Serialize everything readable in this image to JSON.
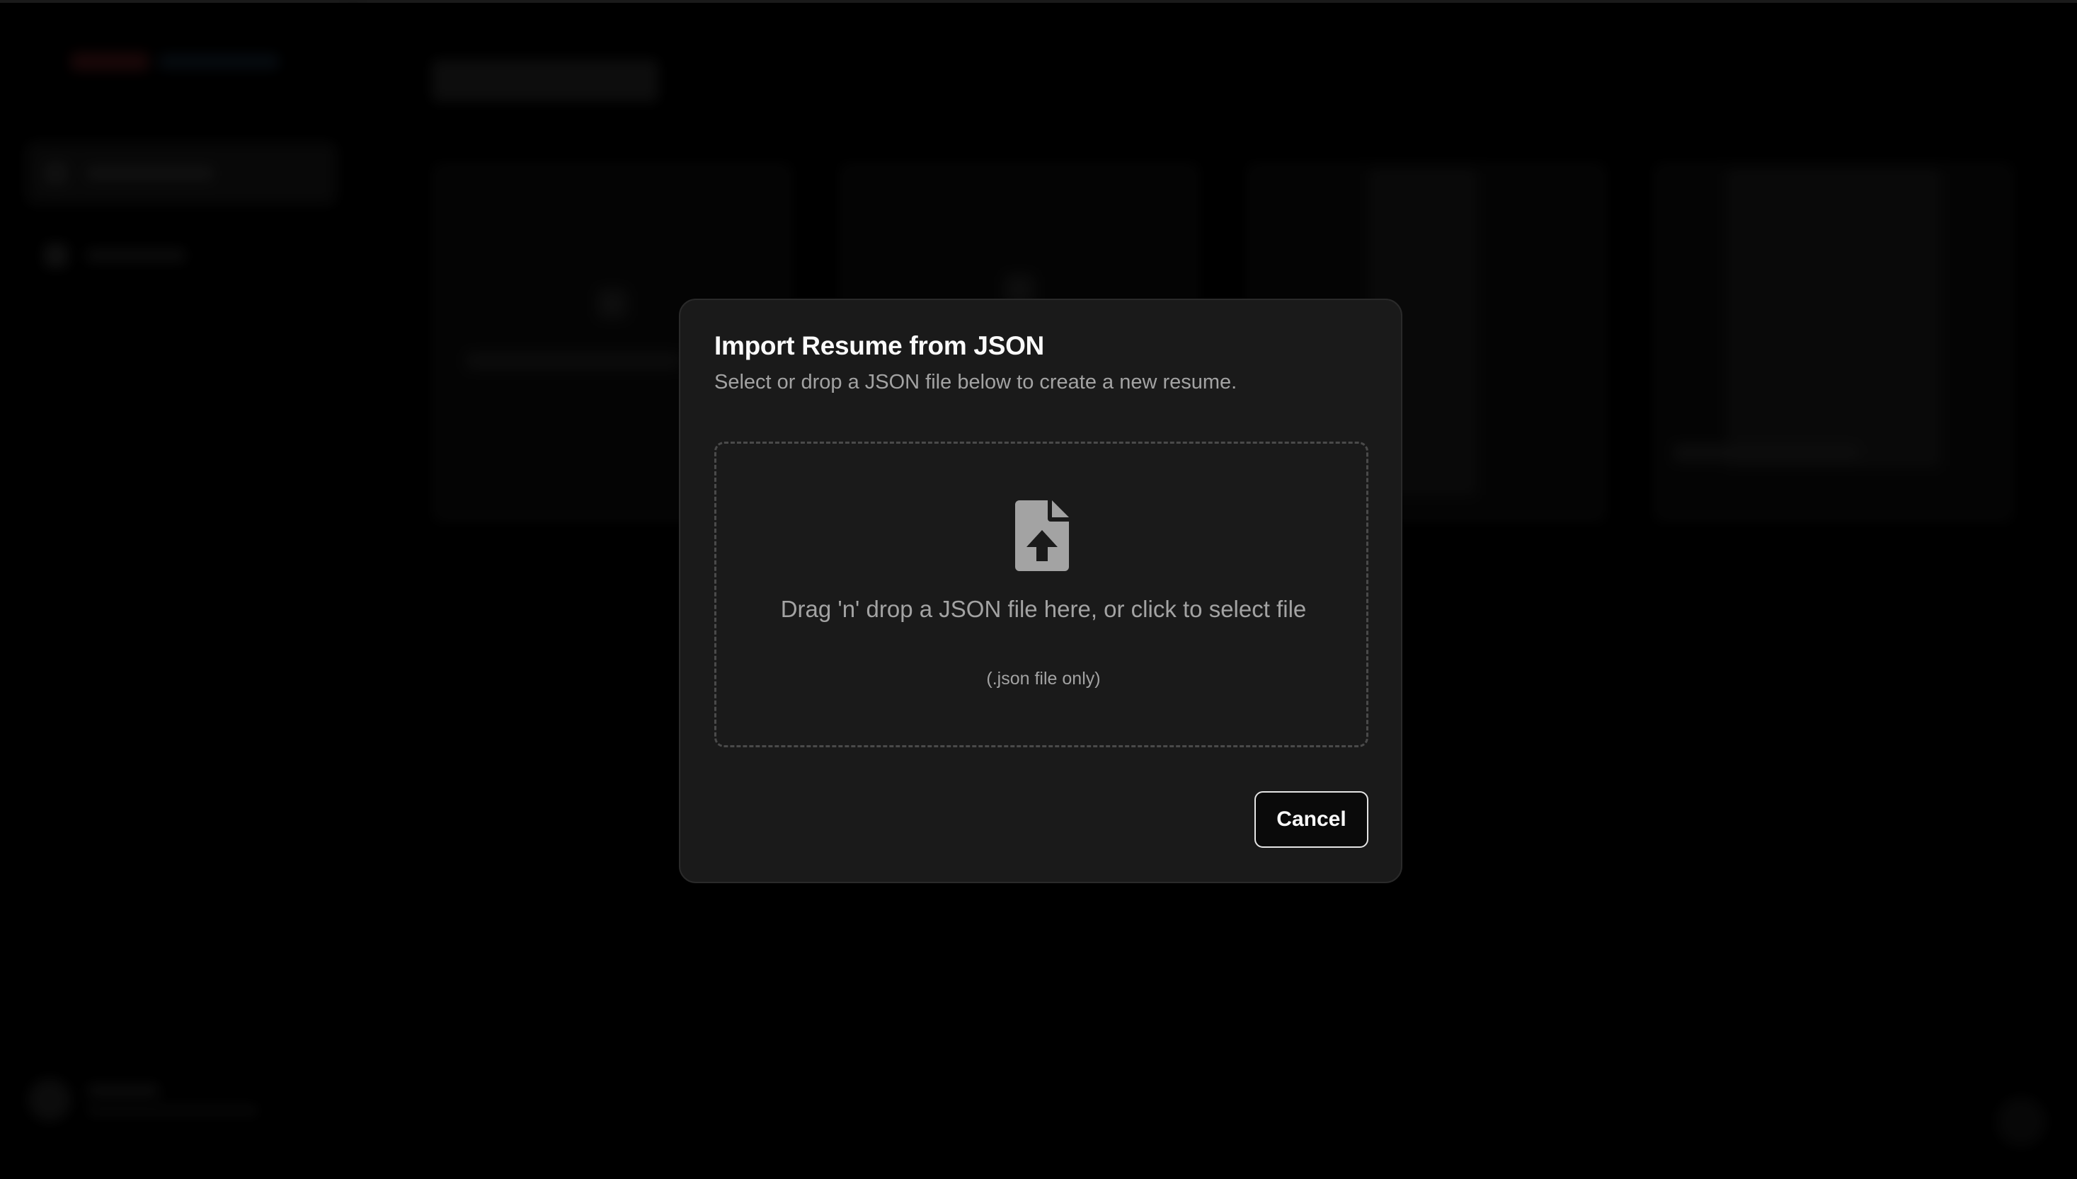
{
  "dialog": {
    "title": "Import Resume from JSON",
    "description": "Select or drop a JSON file below to create a new resume.",
    "dropzone": {
      "icon": "file-upload-icon",
      "text": "Drag 'n' drop a JSON file here, or click to select file",
      "hint": "(.json file only)"
    },
    "cancel_label": "Cancel"
  },
  "colors": {
    "background": "#000000",
    "dialog_bg": "#1a1a1a",
    "muted_text": "#a3a3a3",
    "icon": "#a3a3a3"
  }
}
